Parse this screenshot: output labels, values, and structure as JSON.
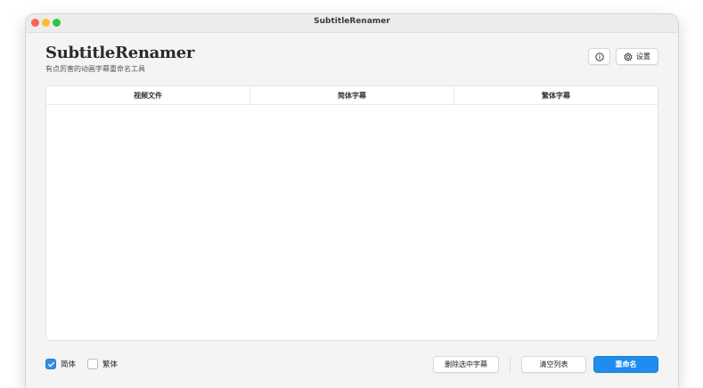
{
  "window": {
    "title": "SubtitleRenamer"
  },
  "header": {
    "app_name": "SubtitleRenamer",
    "subtitle": "有点厉害的动画字幕重命名工具",
    "info_icon": "info-circle-icon",
    "settings_icon": "gear-icon",
    "settings_label": "设置"
  },
  "table": {
    "columns": [
      "视频文件",
      "简体字幕",
      "繁体字幕"
    ],
    "rows": []
  },
  "footer": {
    "simplified": {
      "label": "简体",
      "checked": true
    },
    "traditional": {
      "label": "繁体",
      "checked": false
    },
    "delete_selected_label": "删除选中字幕",
    "clear_list_label": "清空列表",
    "rename_label": "重命名"
  },
  "colors": {
    "accent": "#1f8ded",
    "close": "#fe5f57",
    "minimize": "#febc2e",
    "maximize": "#28c840"
  }
}
